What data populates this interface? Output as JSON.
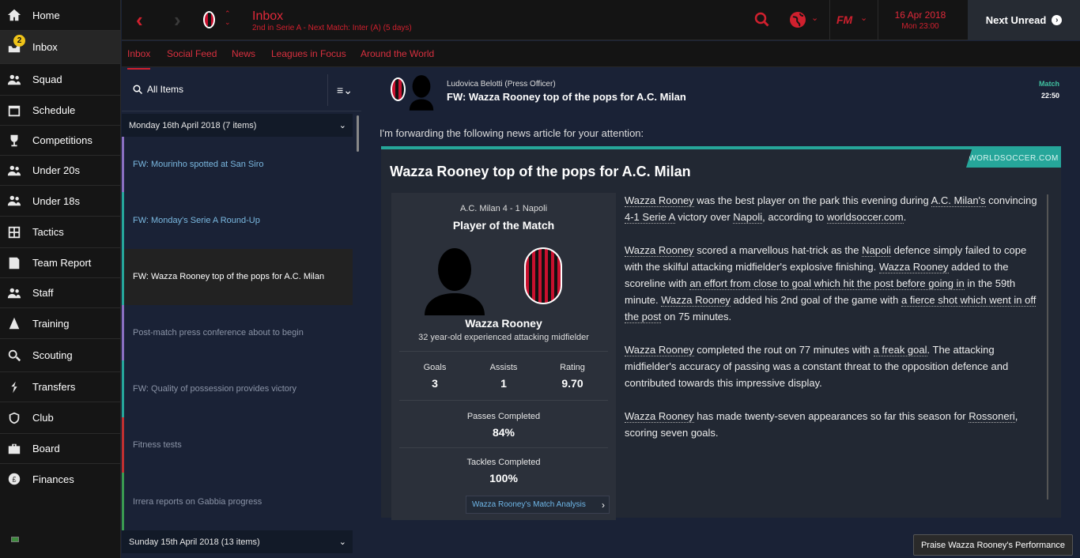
{
  "sidebar": {
    "items": [
      {
        "label": "Home",
        "icon": "home-icon"
      },
      {
        "label": "Inbox",
        "icon": "inbox-icon",
        "badge": "2"
      },
      {
        "label": "Squad",
        "icon": "squad-icon"
      },
      {
        "label": "Schedule",
        "icon": "schedule-icon"
      },
      {
        "label": "Competitions",
        "icon": "trophy-icon"
      },
      {
        "label": "Under 20s",
        "icon": "under-20s-icon"
      },
      {
        "label": "Under 18s",
        "icon": "under-18s-icon"
      },
      {
        "label": "Tactics",
        "icon": "tactics-icon"
      },
      {
        "label": "Team Report",
        "icon": "team-report-icon"
      },
      {
        "label": "Staff",
        "icon": "staff-icon"
      },
      {
        "label": "Training",
        "icon": "training-icon"
      },
      {
        "label": "Scouting",
        "icon": "search-icon"
      },
      {
        "label": "Transfers",
        "icon": "transfers-icon"
      },
      {
        "label": "Club",
        "icon": "club-icon"
      },
      {
        "label": "Board",
        "icon": "board-icon"
      },
      {
        "label": "Finances",
        "icon": "finances-icon"
      }
    ]
  },
  "topbar": {
    "title": "Inbox",
    "subtitle": "2nd in Serie A - Next Match: Inter (A) (5 days)",
    "date": "16 Apr 2018",
    "time": "Mon 23:00",
    "fm_logo": "FM",
    "next_unread": "Next Unread"
  },
  "tabs": [
    "Inbox",
    "Social Feed",
    "News",
    "Leagues in Focus",
    "Around the World"
  ],
  "list": {
    "search_label": "All Items",
    "group1": "Monday 16th April 2018 (7 items)",
    "group2": "Sunday 15th April 2018 (13 items)",
    "messages": [
      {
        "text": "FW: Mourinho spotted at San Siro",
        "color": "#7ab8e0",
        "bar": "#8a6fc0"
      },
      {
        "text": "FW: Monday's Serie A Round-Up",
        "color": "#7ab8e0",
        "bar": "#26a69a"
      },
      {
        "text": "FW: Wazza Rooney top of the pops for A.C. Milan",
        "color": "#ffffff",
        "bar": "#26a69a"
      },
      {
        "text": "Post-match press conference about to begin",
        "color": "#8a93a6",
        "bar": "#8a6fc0"
      },
      {
        "text": "FW: Quality of possession provides victory",
        "color": "#8a93a6",
        "bar": "#26a69a"
      },
      {
        "text": "Fitness tests",
        "color": "#8a93a6",
        "bar": "#c03030"
      },
      {
        "text": "Irrera reports on Gabbia progress",
        "color": "#8a93a6",
        "bar": "#3a9a50"
      }
    ]
  },
  "message": {
    "sender": "Ludovica Belotti  (Press Officer)",
    "title": "FW: Wazza Rooney top of the pops for A.C. Milan",
    "type": "Match",
    "time": "22:50",
    "intro": "I'm forwarding the following news article for your attention:",
    "source": "WORLDSOCCER.COM",
    "article_title": "Wazza Rooney top of the pops for A.C. Milan"
  },
  "stats": {
    "score": "A.C. Milan 4 - 1 Napoli",
    "potm": "Player of the Match",
    "player": "Wazza Rooney",
    "desc": "32 year-old experienced attacking midfielder",
    "goals_label": "Goals",
    "goals": "3",
    "assists_label": "Assists",
    "assists": "1",
    "rating_label": "Rating",
    "rating": "9.70",
    "passes_label": "Passes Completed",
    "passes": "84%",
    "tackles_label": "Tackles Completed",
    "tackles": "100%",
    "analysis": "Wazza Rooney's Match Analysis"
  },
  "article": {
    "p1": [
      {
        "t": "Wazza Rooney",
        "u": true
      },
      {
        "t": " was the best player on the park this evening during "
      },
      {
        "t": "A.C. Milan's",
        "u": true
      },
      {
        "t": " convincing "
      },
      {
        "t": "4-1 Serie A",
        "u": true
      },
      {
        "t": " victory over "
      },
      {
        "t": "Napoli",
        "u": true
      },
      {
        "t": ", according to "
      },
      {
        "t": "worldsoccer.com",
        "u": true
      },
      {
        "t": "."
      }
    ],
    "p2": [
      {
        "t": "Wazza Rooney",
        "u": true
      },
      {
        "t": " scored a marvellous hat-trick as the "
      },
      {
        "t": "Napoli",
        "u": true
      },
      {
        "t": " defence simply failed to cope with the skilful attacking midfielder's explosive finishing. "
      },
      {
        "t": "Wazza Rooney",
        "u": true
      },
      {
        "t": " added to the scoreline with "
      },
      {
        "t": "an effort from close to goal which hit the post before going in",
        "u": true
      },
      {
        "t": " in the 59th minute. "
      },
      {
        "t": "Wazza Rooney",
        "u": true
      },
      {
        "t": " added his 2nd goal of the game with "
      },
      {
        "t": "a fierce shot which went in off the post",
        "u": true
      },
      {
        "t": " on 75 minutes."
      }
    ],
    "p3": [
      {
        "t": "Wazza Rooney",
        "u": true
      },
      {
        "t": " completed the rout on 77 minutes with "
      },
      {
        "t": "a freak goal",
        "u": true
      },
      {
        "t": ". The attacking midfielder's accuracy of passing was a constant threat to the opposition defence and contributed towards this impressive display."
      }
    ],
    "p4": [
      {
        "t": "Wazza Rooney",
        "u": true
      },
      {
        "t": " has made twenty-seven appearances so far this season for "
      },
      {
        "t": "Rossoneri",
        "u": true
      },
      {
        "t": ", scoring seven goals."
      }
    ]
  },
  "praise_button": "Praise Wazza Rooney's Performance",
  "colors": {
    "accent": "#d0202e",
    "teal": "#26a69a"
  }
}
